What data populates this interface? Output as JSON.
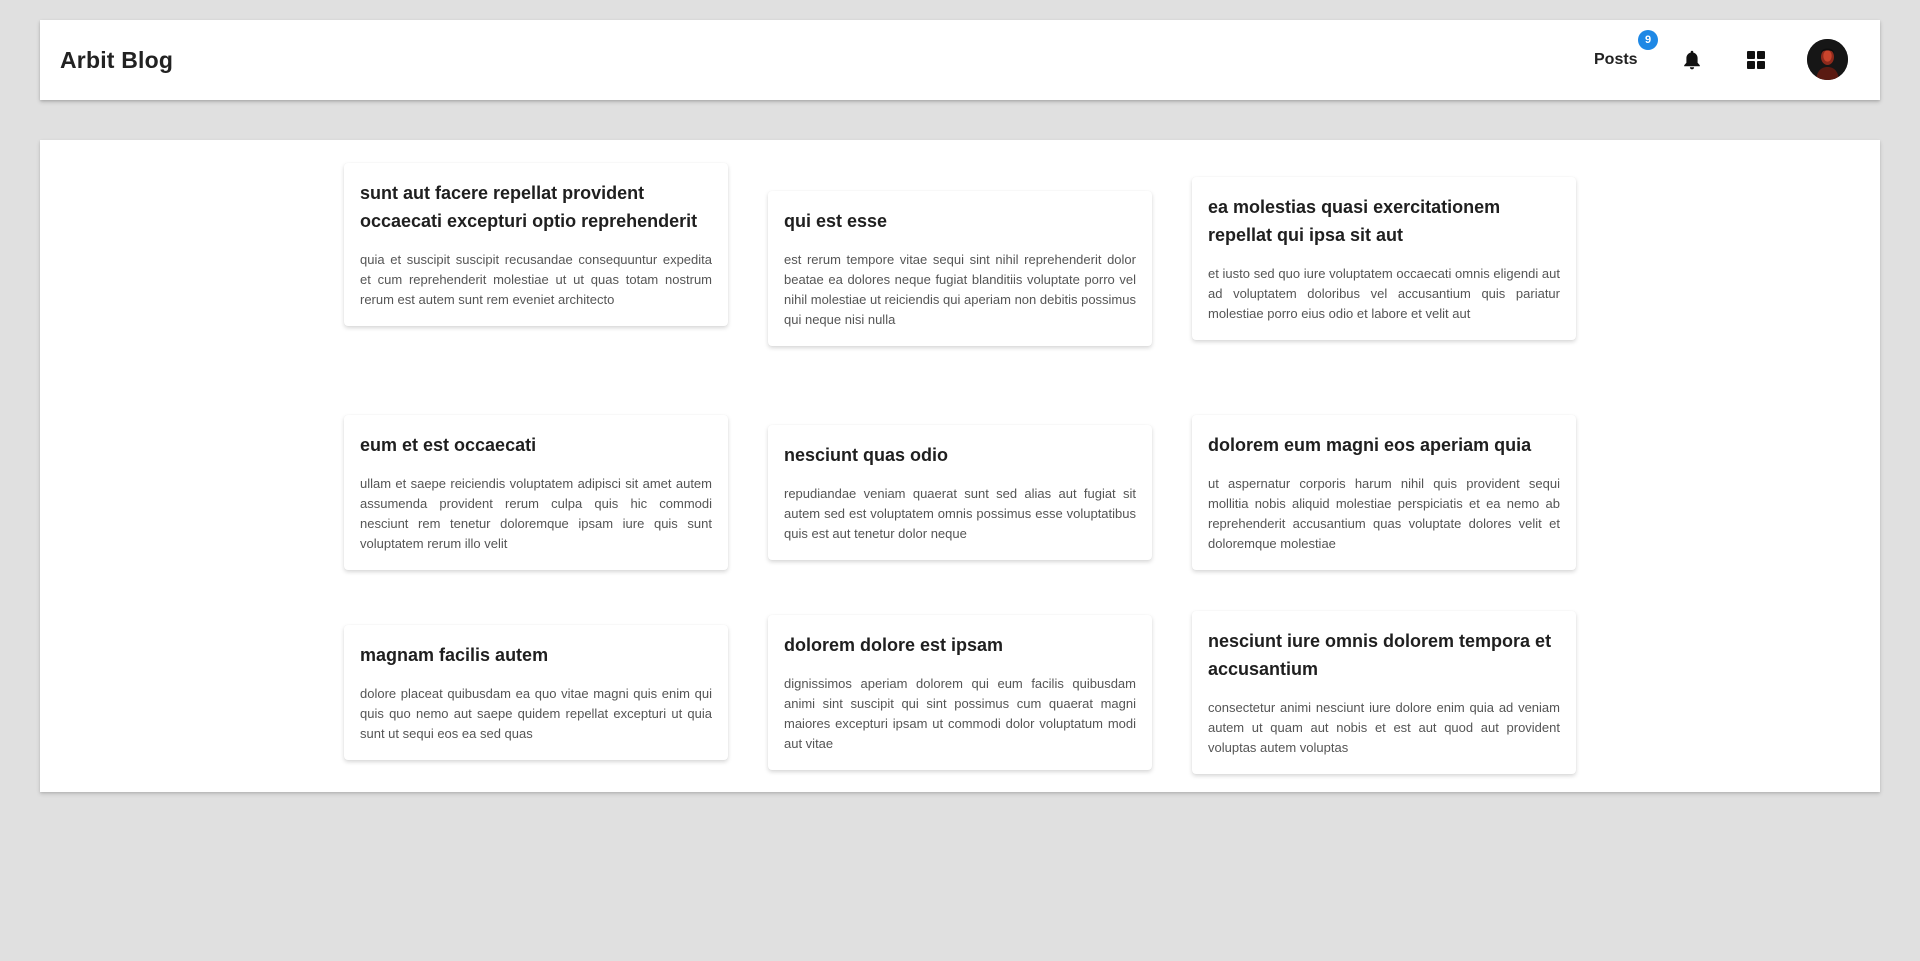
{
  "header": {
    "brand": "Arbit Blog",
    "posts_label": "Posts",
    "posts_badge": "9"
  },
  "icons": {
    "bell": "bell-icon",
    "apps": "apps-grid-icon",
    "avatar": "user-avatar"
  },
  "colors": {
    "badge": "#1e88e5",
    "page_background": "#e0e0e0",
    "surface": "#ffffff"
  },
  "posts": [
    {
      "title": "sunt aut facere repellat provident occaecati excepturi optio reprehenderit",
      "body": "quia et suscipit suscipit recusandae consequuntur expedita et cum reprehenderit molestiae ut ut quas totam nostrum rerum est autem sunt rem eveniet architecto"
    },
    {
      "title": "qui est esse",
      "body": "est rerum tempore vitae sequi sint nihil reprehenderit dolor beatae ea dolores neque fugiat blanditiis voluptate porro vel nihil molestiae ut reiciendis qui aperiam non debitis possimus qui neque nisi nulla"
    },
    {
      "title": "ea molestias quasi exercitationem repellat qui ipsa sit aut",
      "body": "et iusto sed quo iure voluptatem occaecati omnis eligendi aut ad voluptatem doloribus vel accusantium quis pariatur molestiae porro eius odio et labore et velit aut"
    },
    {
      "title": "eum et est occaecati",
      "body": "ullam et saepe reiciendis voluptatem adipisci sit amet autem assumenda provident rerum culpa quis hic commodi nesciunt rem tenetur doloremque ipsam iure quis sunt voluptatem rerum illo velit"
    },
    {
      "title": "nesciunt quas odio",
      "body": "repudiandae veniam quaerat sunt sed alias aut fugiat sit autem sed est voluptatem omnis possimus esse voluptatibus quis est aut tenetur dolor neque"
    },
    {
      "title": "dolorem eum magni eos aperiam quia",
      "body": "ut aspernatur corporis harum nihil quis provident sequi mollitia nobis aliquid molestiae perspiciatis et ea nemo ab reprehenderit accusantium quas voluptate dolores velit et doloremque molestiae"
    },
    {
      "title": "magnam facilis autem",
      "body": "dolore placeat quibusdam ea quo vitae magni quis enim qui quis quo nemo aut saepe quidem repellat excepturi ut quia sunt ut sequi eos ea sed quas"
    },
    {
      "title": "dolorem dolore est ipsam",
      "body": "dignissimos aperiam dolorem qui eum facilis quibusdam animi sint suscipit qui sint possimus cum quaerat magni maiores excepturi ipsam ut commodi dolor voluptatum modi aut vitae"
    },
    {
      "title": "nesciunt iure omnis dolorem tempora et accusantium",
      "body": "consectetur animi nesciunt iure dolore enim quia ad veniam autem ut quam aut nobis et est aut quod aut provident voluptas autem voluptas"
    }
  ]
}
